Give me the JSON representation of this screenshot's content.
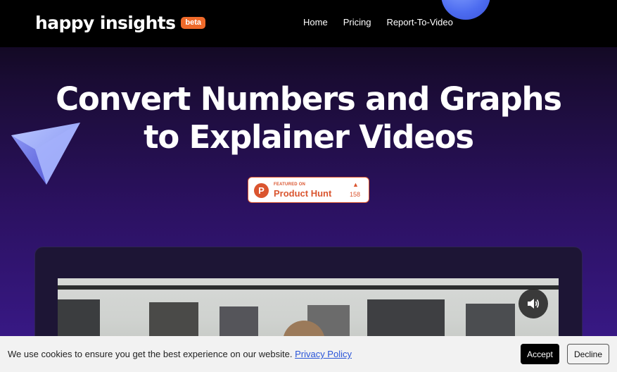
{
  "nav": {
    "logo_text": "happy insights",
    "beta_label": "beta",
    "links": [
      {
        "label": "Home"
      },
      {
        "label": "Pricing"
      },
      {
        "label": "Report-To-Video"
      }
    ]
  },
  "hero": {
    "title_line1": "Convert Numbers and Graphs",
    "title_line2": "to Explainer Videos"
  },
  "product_hunt": {
    "featured_label": "FEATURED ON",
    "name": "Product Hunt",
    "logo_letter": "P",
    "upvote_arrow": "▲",
    "upvotes": "158"
  },
  "video": {
    "sound_icon": "speaker-icon"
  },
  "cookie_banner": {
    "message": "We use cookies to ensure you get the best experience on our website.",
    "policy_link": "Privacy Policy",
    "accept_label": "Accept",
    "decline_label": "Decline"
  },
  "colors": {
    "accent_orange": "#ef6a2a",
    "product_hunt_red": "#da552f",
    "link_blue": "#2a55d8"
  }
}
